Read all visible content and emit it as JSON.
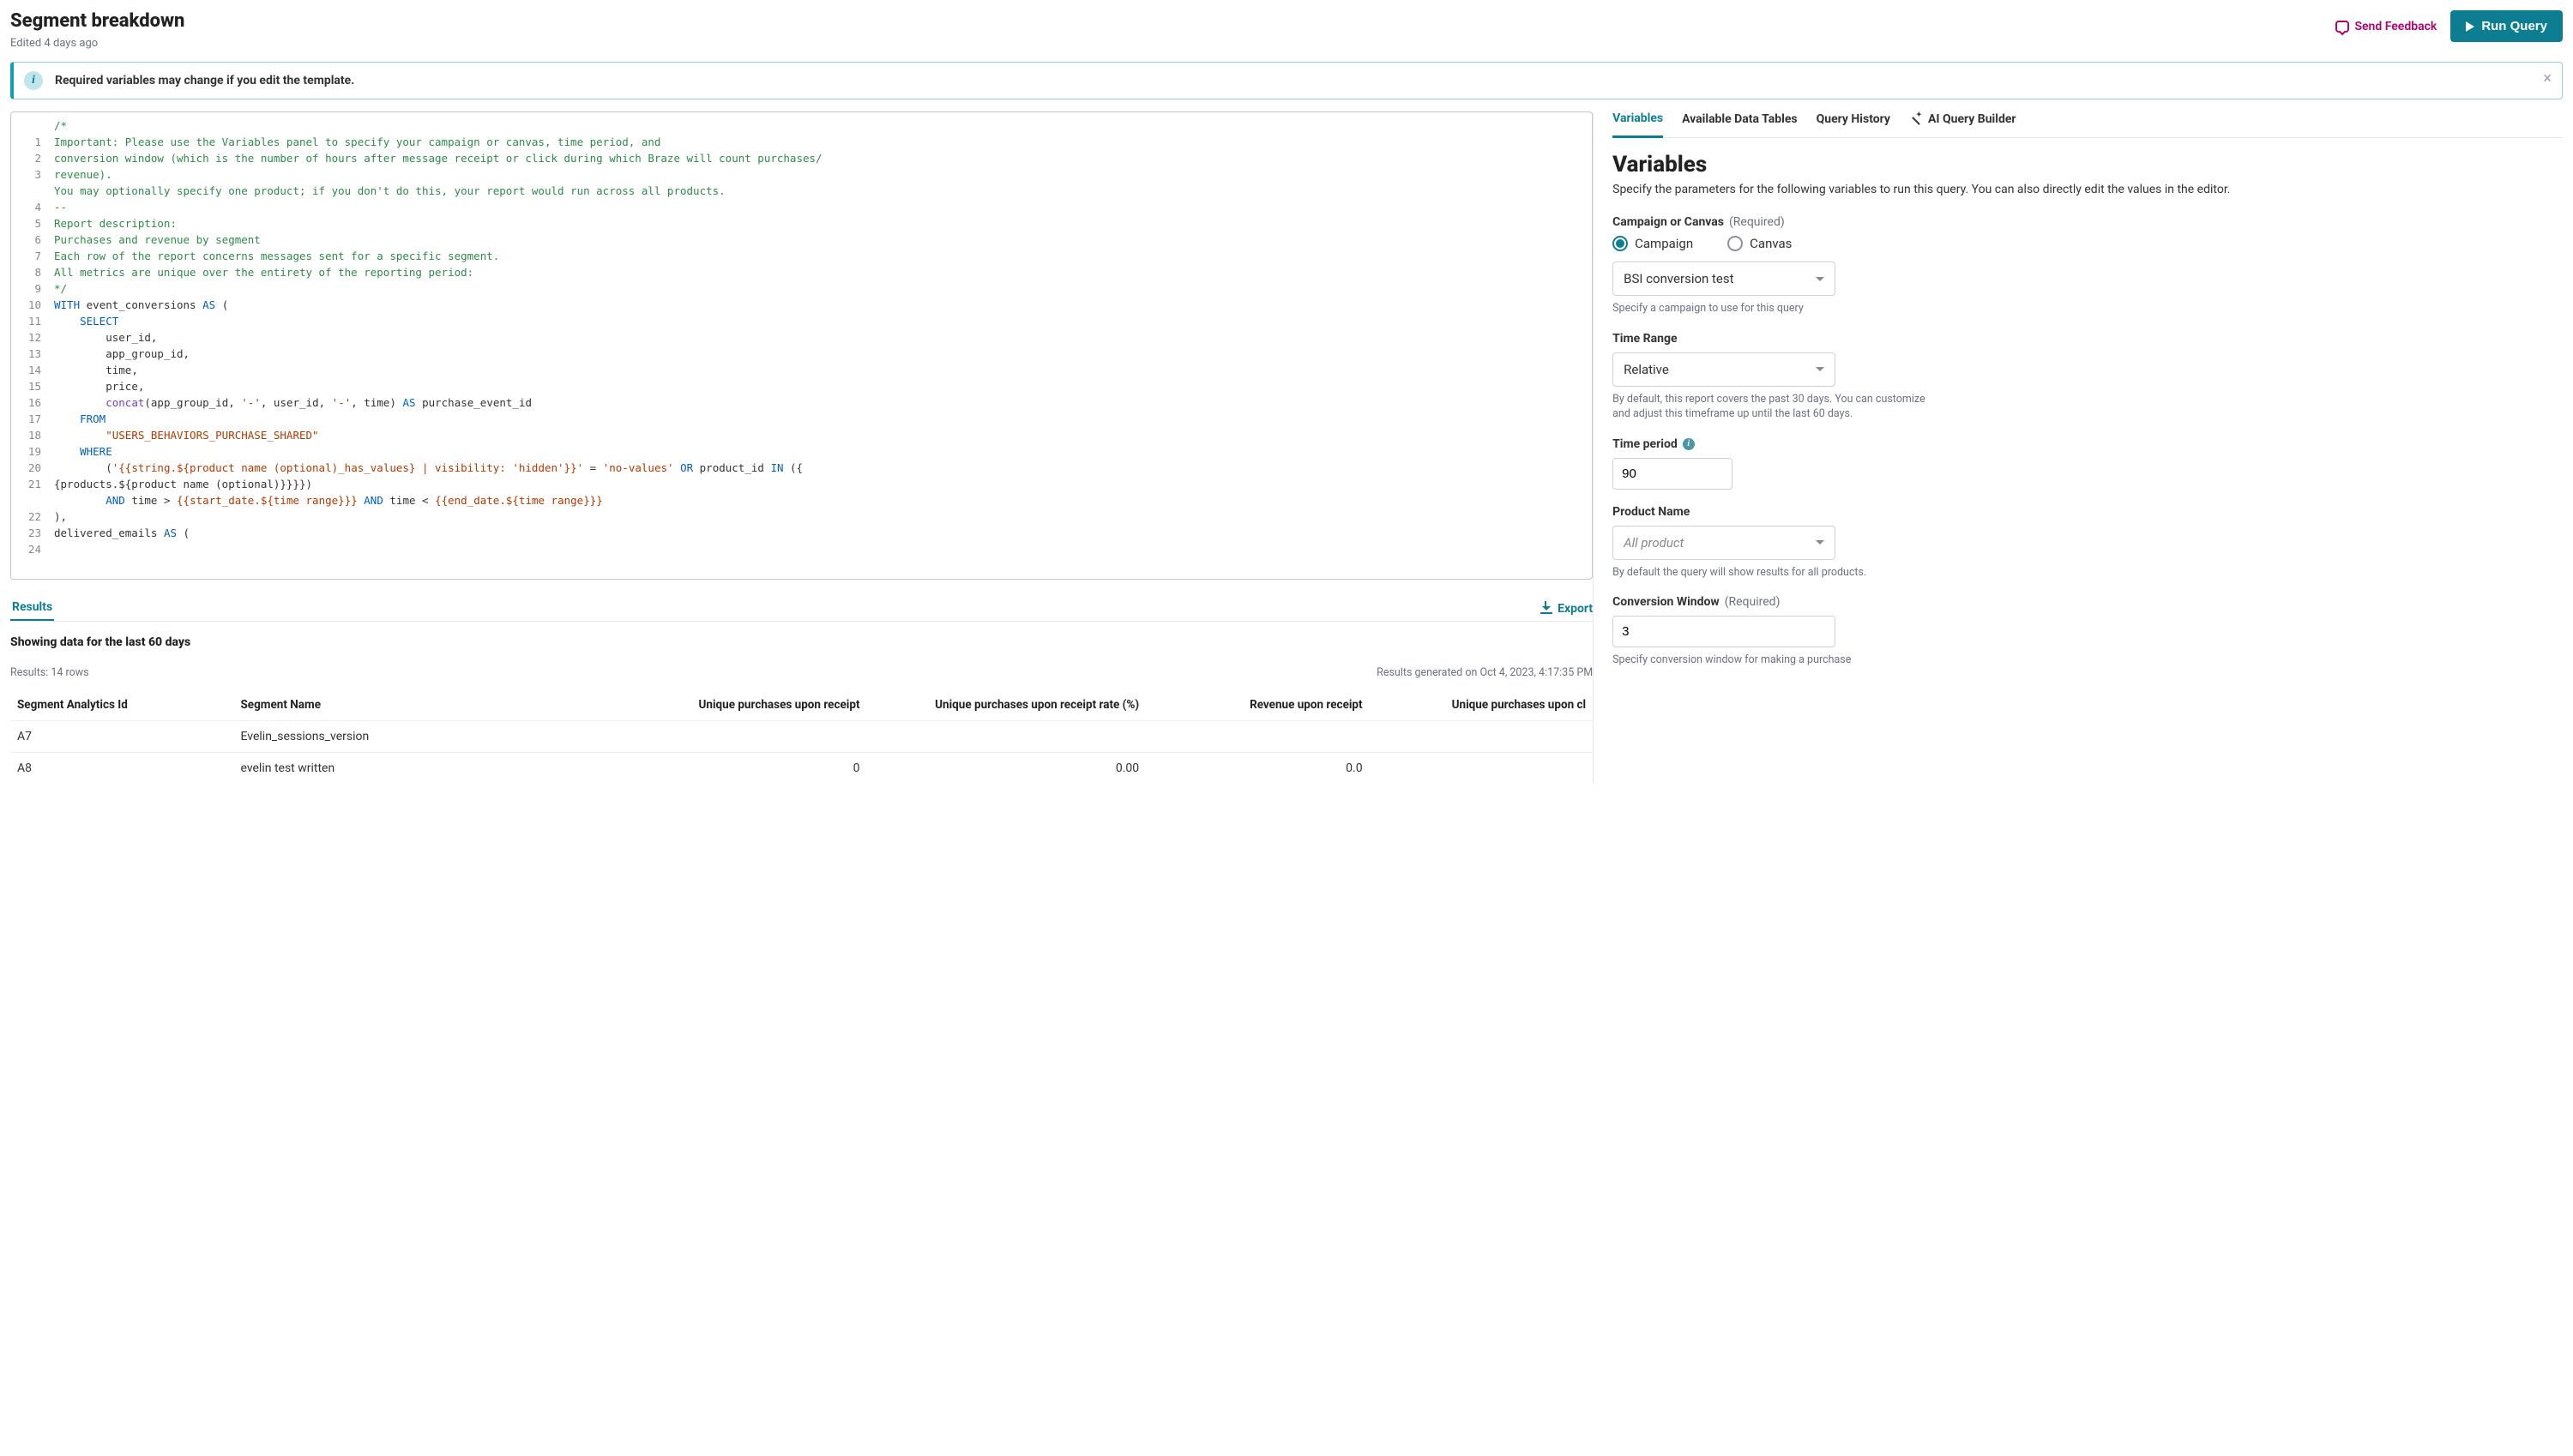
{
  "header": {
    "title": "Segment breakdown",
    "edited": "Edited 4 days ago",
    "feedback": "Send Feedback",
    "run": "Run Query"
  },
  "banner": {
    "text": "Required variables may change if you edit the template."
  },
  "editor": {
    "lines": [
      "1",
      "2",
      "3",
      "4",
      "5",
      "6",
      "7",
      "8",
      "9",
      "10",
      "11",
      "12",
      "13",
      "14",
      "15",
      "16",
      "17",
      "18",
      "19",
      "20",
      "21",
      "22",
      "23",
      "24"
    ],
    "code": {
      "l1": "/*",
      "l2": "Important: Please use the Variables panel to specify your campaign or canvas, time period, and",
      "l3": "conversion window (which is the number of hours after message receipt or click during which Braze will count purchases/",
      "l3b": "revenue).",
      "l4": "You may optionally specify one product; if you don't do this, your report would run across all products.",
      "l5": "--",
      "l6": "Report description:",
      "l7": "Purchases and revenue by segment",
      "l8": "Each row of the report concerns messages sent for a specific segment.",
      "l9": "All metrics are unique over the entirety of the reporting period:",
      "l10": "*/",
      "kw_with": "WITH",
      "kw_as": "AS",
      "kw_select": "SELECT",
      "kw_from": "FROM",
      "kw_where": "WHERE",
      "kw_and": "AND",
      "kw_or": "OR",
      "kw_in": "IN",
      "id_event": "event_conversions",
      "id_userid": "user_id",
      "id_appgroup": "app_group_id",
      "id_time": "time",
      "id_price": "price",
      "fn_concat": "concat",
      "alias_pe": "purchase_event_id",
      "tbl": "\"USERS_BEHAVIORS_PURCHASE_SHARED\"",
      "str_hidden": "'hidden'",
      "str_novalues": "'no-values'",
      "str_dash": "'-'",
      "var_pname_has": "{{string.${product name (optional)_has_values} | visibility: ",
      "var_close": "}}",
      "prod_tail": " = ",
      "prod_in_tail": " product_id ",
      "prod_wrap_open": " ({",
      "prod_wrap": "{products.${product name (optional)}}}})",
      "var_start": "{{start_date.${",
      "var_end": "{{end_date.${",
      "var_timerange": "time range",
      "var_close2": "}}}",
      "id_delivered": "delivered_emails"
    }
  },
  "results": {
    "tab": "Results",
    "export": "Export",
    "showing": "Showing data for the last 60 days",
    "meta_left": "Results: 14 rows",
    "meta_right": "Results generated on Oct 4, 2023, 4:17:35 PM",
    "cols": {
      "c1": "Segment Analytics Id",
      "c2": "Segment Name",
      "c3": "Unique purchases upon receipt",
      "c4": "Unique purchases upon receipt rate (%)",
      "c5": "Revenue upon receipt",
      "c6": "Unique purchases upon cl"
    },
    "rows": [
      {
        "id": "A7",
        "name": "Evelin_sessions_version",
        "p": "",
        "rate": "",
        "rev": "",
        "cl": ""
      },
      {
        "id": "A8",
        "name": "evelin test written",
        "p": "0",
        "rate": "0.00",
        "rev": "0.0",
        "cl": ""
      }
    ]
  },
  "panel": {
    "tabs": {
      "t1": "Variables",
      "t2": "Available Data Tables",
      "t3": "Query History",
      "t4": "AI Query Builder"
    },
    "title": "Variables",
    "desc": "Specify the parameters for the following variables to run this query. You can also directly edit the values in the editor.",
    "f1_label": "Campaign or Canvas",
    "f1_required": "(Required)",
    "f1_radio_a": "Campaign",
    "f1_radio_b": "Canvas",
    "f1_select": "BSI conversion test",
    "f1_help": "Specify a campaign to use for this query",
    "f2_label": "Time Range",
    "f2_select": "Relative",
    "f2_help": "By default, this report covers the past 30 days. You can customize and adjust this timeframe up until the last 60 days.",
    "f3_label": "Time period",
    "f3_value": "90",
    "f4_label": "Product Name",
    "f4_placeholder": "All product",
    "f4_help": "By default the query will show results for all products.",
    "f5_label": "Conversion Window",
    "f5_required": "(Required)",
    "f5_value": "3",
    "f5_help": "Specify conversion window for making a purchase"
  }
}
